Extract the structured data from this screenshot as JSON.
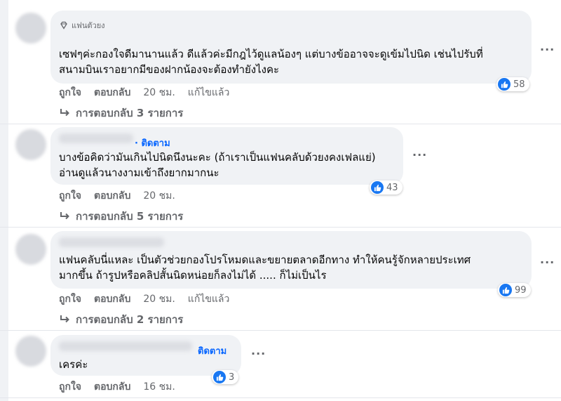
{
  "colors": {
    "bubble": "#f0f2f5",
    "link": "#0866ff",
    "meta": "#65676b",
    "like": "#1877f2"
  },
  "comments": [
    {
      "badge": "แฟนตัวยง",
      "follow": "",
      "lines": [
        "เซฟๆค่ะกองใจดีมานานแล้ว ดีแล้วค่ะมีกฎไว้ดูแลน้องๆ แต่บางข้ออาจจะดูเข้มไปนิด เช่นไปรับที่",
        "สนามบินเราอยากมีของฝากน้องจะต้องทำยังไงคะ"
      ],
      "like": "ถูกใจ",
      "reply": "ตอบกลับ",
      "time": "20 ชม.",
      "edited": "แก้ไขแล้ว",
      "reactions": "58",
      "replies": "การตอบกลับ 3 รายการ"
    },
    {
      "badge": "",
      "follow": "· ติดตาม",
      "lines": [
        "บางข้อคิดว่ามันเกินไปนิดนึงนะคะ (ถ้าเราเป็นแฟนคลับด้วยงคงเฟลแย่)",
        "อ่านดูแล้วนางงามเข้าถึงยากมากนะ"
      ],
      "like": "ถูกใจ",
      "reply": "ตอบกลับ",
      "time": "20 ชม.",
      "edited": "",
      "reactions": "43",
      "replies": "การตอบกลับ 5 รายการ"
    },
    {
      "badge": "",
      "follow": "",
      "lines": [
        "แฟนคลับนี่แหละ เป็นตัวช่วยกองโปรโหมดและขยายตลาดอีกทาง ทำให้คนรู้จักหลายประเทศ",
        "มากขึ้น ถ้ารูปหรือคลิปสั้นนิดหน่อยก็ลงไม่ได้ ..... ก็ไม่เป็นไร"
      ],
      "like": "ถูกใจ",
      "reply": "ตอบกลับ",
      "time": "20 ชม.",
      "edited": "แก้ไขแล้ว",
      "reactions": "99",
      "replies": "การตอบกลับ 2 รายการ"
    },
    {
      "badge": "",
      "follow": "ติดตาม",
      "lines": [
        "เครค่ะ"
      ],
      "like": "ถูกใจ",
      "reply": "ตอบกลับ",
      "time": "16 ชม.",
      "edited": "",
      "reactions": "3",
      "replies": ""
    }
  ],
  "more_icon": "..."
}
